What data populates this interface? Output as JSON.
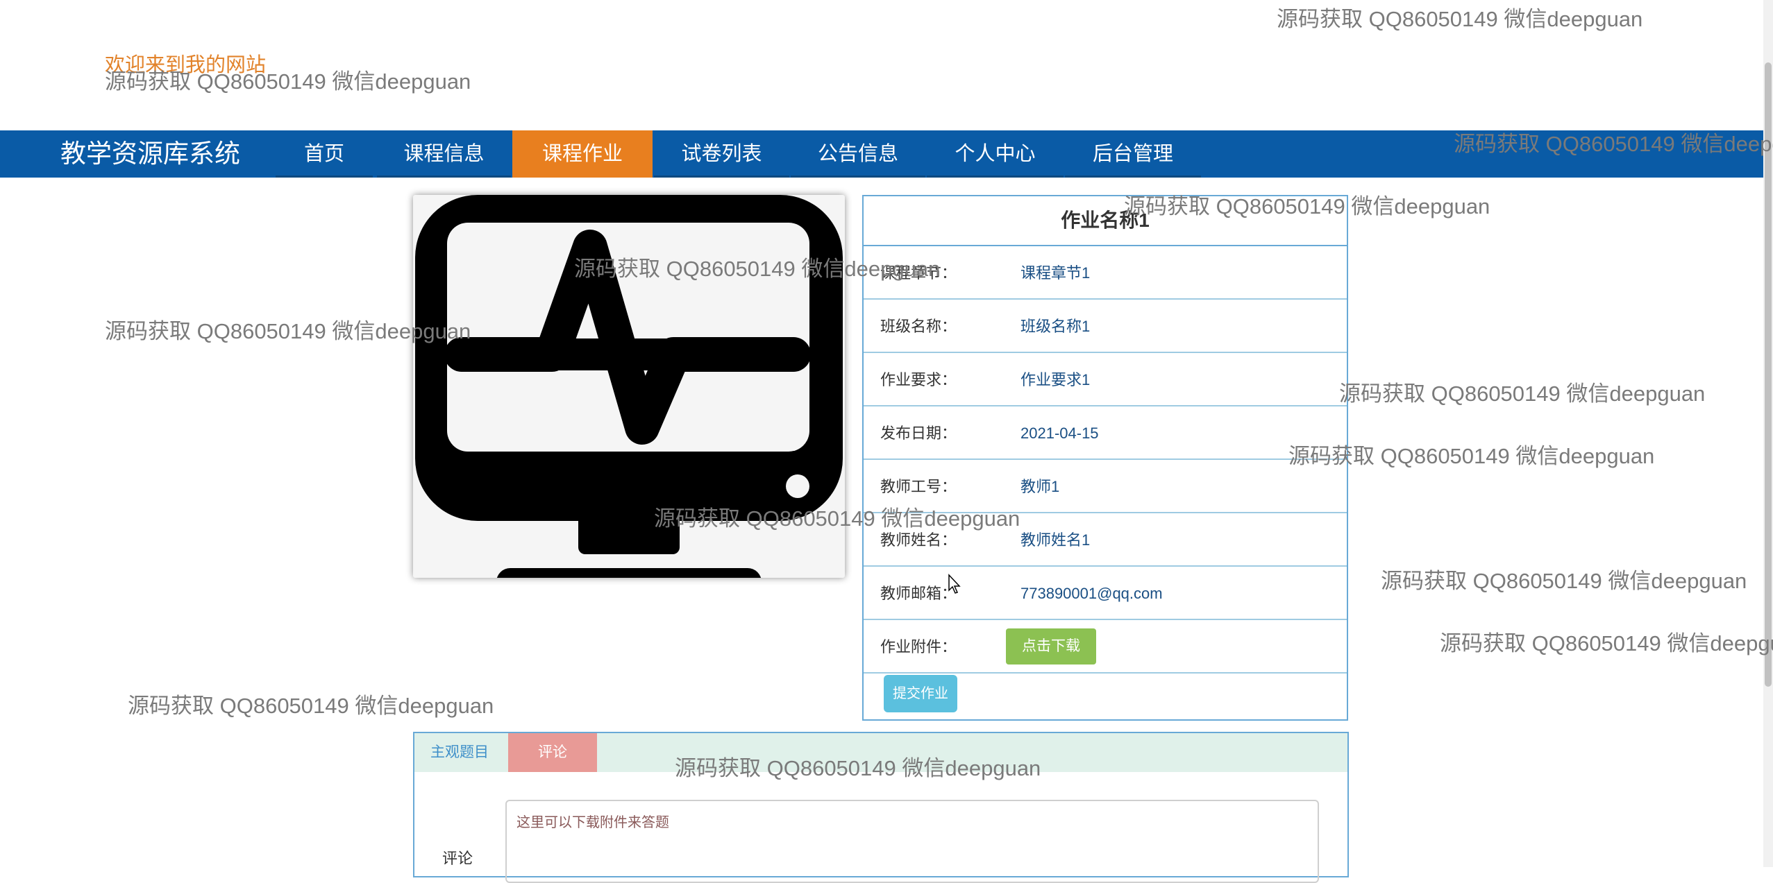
{
  "header": {
    "welcome": "欢迎来到我的网站"
  },
  "nav": {
    "brand": "教学资源库系统",
    "items": [
      "首页",
      "课程信息",
      "课程作业",
      "试卷列表",
      "公告信息",
      "个人中心",
      "后台管理"
    ],
    "active": "课程作业"
  },
  "detail": {
    "title": "作业名称1",
    "rows": [
      {
        "label": "课程章节：",
        "value": "课程章节1"
      },
      {
        "label": "班级名称：",
        "value": "班级名称1"
      },
      {
        "label": "作业要求：",
        "value": "作业要求1"
      },
      {
        "label": "发布日期：",
        "value": "2021-04-15"
      },
      {
        "label": "教师工号：",
        "value": "教师1"
      },
      {
        "label": "教师姓名：",
        "value": "教师姓名1"
      },
      {
        "label": "教师邮箱：",
        "value": "773890001@qq.com"
      }
    ],
    "attachment_label": "作业附件：",
    "download_button": "点击下载",
    "submit_button": "提交作业"
  },
  "image": {
    "icon": "monitor-heartbeat-icon"
  },
  "tabs": {
    "items": [
      "主观题目",
      "评论"
    ]
  },
  "comment": {
    "label": "评论",
    "placeholder": "这里可以下载附件来答题"
  },
  "watermark": "源码获取 QQ86050149 微信deepguan",
  "colors": {
    "nav": "#0a5ba6",
    "active": "#e87f1f",
    "welcome": "#e2832b",
    "download": "#8cc152",
    "submit": "#5bc0de",
    "tab_active": "#e89a96"
  }
}
